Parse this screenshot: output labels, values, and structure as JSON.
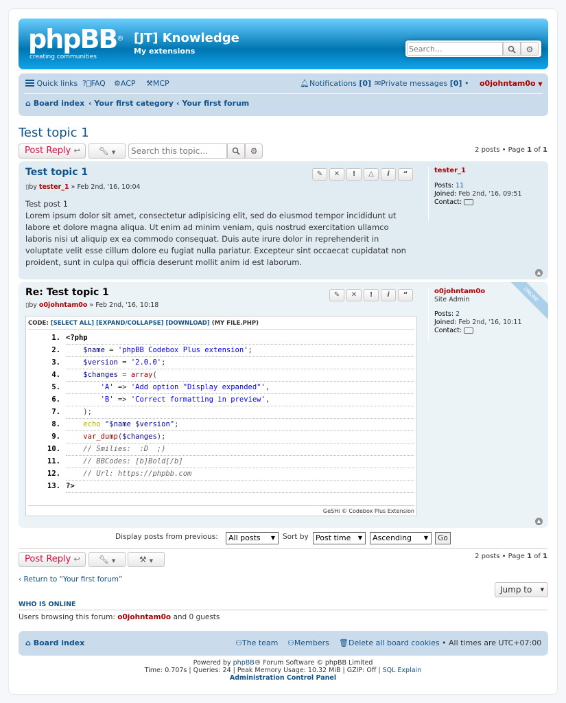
{
  "site": {
    "logo_text": "phpBB",
    "logo_reg": "®",
    "logo_sub": "creating communities",
    "title": "[JT] Knowledge",
    "description": "My extensions",
    "search_placeholder": "Search…"
  },
  "nav": {
    "quick_links": "Quick links",
    "faq": "FAQ",
    "acp": "ACP",
    "mcp": "MCP",
    "notifications": "Notifications",
    "notifications_count": "[0]",
    "private_messages": "Private messages",
    "pm_count": "[0]",
    "username": "o0johntam0o",
    "breadcrumbs": [
      "Board index",
      "Your first category",
      "Your first forum"
    ]
  },
  "topic": {
    "title": "Test topic 1",
    "reply_label": "Post Reply",
    "search_placeholder": "Search this topic…",
    "pagination": {
      "prefix": "2 posts • Page ",
      "page": "1",
      "of": " of ",
      "total": "1"
    }
  },
  "posts": [
    {
      "title": "Test topic 1",
      "by": "by",
      "author": "tester_1",
      "date": "» Feb 2nd, '16, 10:04",
      "body_line1": "Test post 1",
      "body_line2": "Lorem ipsum dolor sit amet, consectetur adipisicing elit, sed do eiusmod tempor incididunt ut labore et dolore magna aliqua. Ut enim ad minim veniam, quis nostrud exercitation ullamco laboris nisi ut aliquip ex ea commodo consequat. Duis aute irure dolor in reprehenderit in voluptate velit esse cillum dolore eu fugiat nulla pariatur. Excepteur sint occaecat cupidatat non proident, sunt in culpa qui officia deserunt mollit anim id est laborum.",
      "profile": {
        "name": "tester_1",
        "posts_label": "Posts:",
        "posts": "11",
        "joined_label": "Joined:",
        "joined": "Feb 2nd, '16, 09:51",
        "contact_label": "Contact:"
      }
    },
    {
      "title": "Re: Test topic 1",
      "by": "by",
      "author": "o0johntam0o",
      "date": "» Feb 2nd, '16, 10:18",
      "online_badge": "ONLINE",
      "profile": {
        "name": "o0johntam0o",
        "rank": "Site Admin",
        "posts_label": "Posts:",
        "posts": "2",
        "joined_label": "Joined:",
        "joined": "Feb 2nd, '16, 10:11",
        "contact_label": "Contact:"
      },
      "code": {
        "label": "CODE:",
        "select_all": "[SELECT ALL]",
        "expand": "[EXPAND/COLLAPSE]",
        "download": "[DOWNLOAD]",
        "file": "(MY FILE.PHP)",
        "footer": "GeSHi © Codebox Plus Extension",
        "lines": [
          "1.",
          "2.",
          "3.",
          "4.",
          "5.",
          "6.",
          "7.",
          "8.",
          "9.",
          "10.",
          "11.",
          "12.",
          "13."
        ]
      }
    }
  ],
  "display": {
    "label": "Display posts from previous:",
    "all_posts": "All posts",
    "sort_by": "Sort by",
    "post_time": "Post time",
    "ascending": "Ascending",
    "go": "Go"
  },
  "bottom": {
    "reply_label": "Post Reply",
    "pagination_prefix": "2 posts • Page ",
    "page": "1",
    "of": " of ",
    "total": "1",
    "return_link": "Return to “Your first forum”",
    "jump_to": "Jump to"
  },
  "online": {
    "heading": "WHO IS ONLINE",
    "prefix": "Users browsing this forum: ",
    "user": "o0johntam0o",
    "suffix": " and 0 guests"
  },
  "footer": {
    "board_index": "Board index",
    "team": "The team",
    "members": "Members",
    "delete_cookies": "Delete all board cookies",
    "times": "• All times are UTC+07:00"
  },
  "credits": {
    "powered_prefix": "Powered by ",
    "phpbb": "phpBB",
    "powered_suffix": "® Forum Software © phpBB Limited",
    "stats": "Time: 0.707s | Queries: 24 | Peak Memory Usage: 10.32 MiB | GZIP: Off | ",
    "sql_explain": "SQL Explain",
    "acp": "Administration Control Panel"
  },
  "colors": {
    "accent": "#105289",
    "header_start": "#6aceff",
    "header_end": "#0076b1",
    "navbar": "#cadceb",
    "username": "#aa0000",
    "reply": "#d31141"
  }
}
